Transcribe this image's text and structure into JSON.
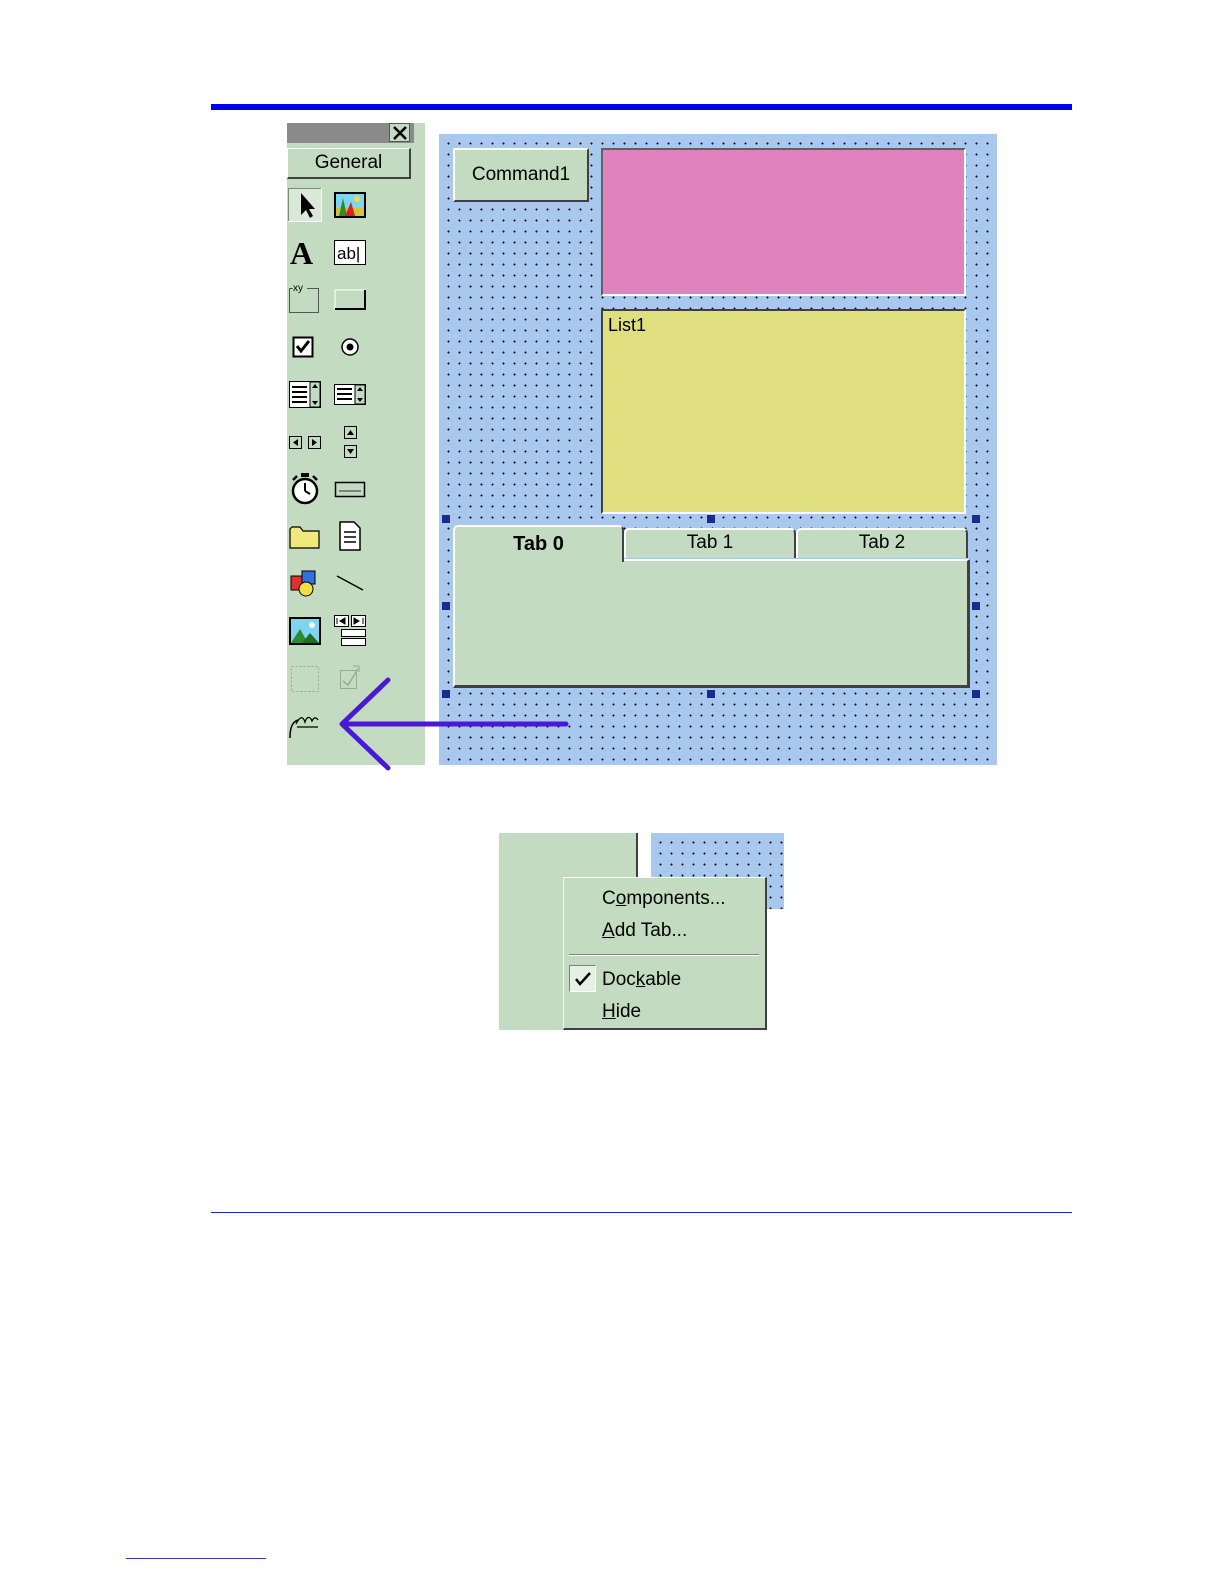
{
  "toolbox": {
    "tab_label": "General",
    "tools": [
      "pointer-icon",
      "picturebox-icon",
      "label-icon",
      "textbox-icon",
      "frame-icon",
      "commandbutton-icon",
      "checkbox-icon",
      "optionbutton-icon",
      "combobox-icon",
      "listbox-icon",
      "hscrollbar-icon",
      "vscrollbar-icon",
      "timer-icon",
      "drivelistbox-icon",
      "dirlistbox-icon",
      "filelistbox-icon",
      "shape-icon",
      "line-icon",
      "image-icon",
      "data-icon",
      "ole-icon",
      "disabled-control-icon",
      "custom-control-icon"
    ]
  },
  "form": {
    "command_button": "Command1",
    "list_label": "List1",
    "tabs": {
      "t0": "Tab 0",
      "t1": "Tab 1",
      "t2": "Tab 2"
    }
  },
  "context_menu": {
    "components": {
      "pre": "C",
      "key": "o",
      "post": "mponents..."
    },
    "add_tab": {
      "pre": "",
      "key": "A",
      "post": "dd Tab..."
    },
    "dockable": {
      "pre": "Doc",
      "key": "k",
      "post": "able",
      "checked": true
    },
    "hide": {
      "pre": "",
      "key": "H",
      "post": "ide"
    }
  },
  "colors": {
    "rule": "#0000ee",
    "panel_green": "#c3dcc1",
    "form_blue": "#a9c8ee",
    "pink": "#df82bd",
    "yellow": "#e0df80",
    "arrow": "#4b18d6",
    "handle": "#1c2a8c"
  }
}
